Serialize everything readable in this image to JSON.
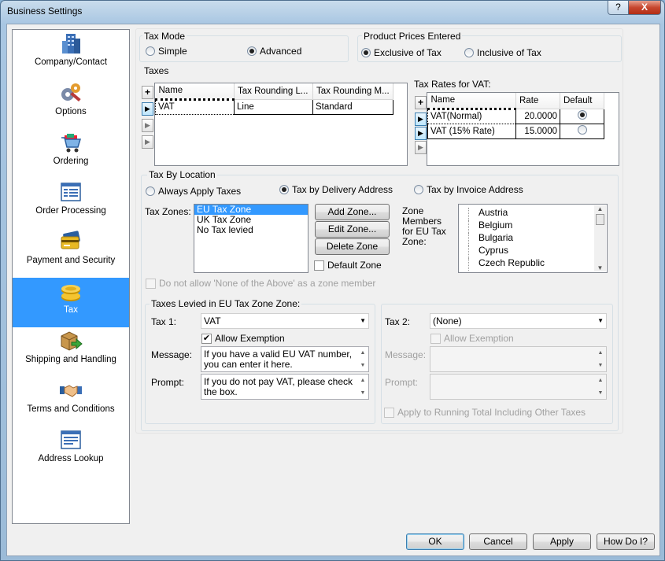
{
  "window": {
    "title": "Business Settings",
    "help_label": "?",
    "close_label": "X"
  },
  "sidebar": {
    "items": [
      {
        "label": "Company/Contact",
        "icon": "building-icon"
      },
      {
        "label": "Options",
        "icon": "gears-icon"
      },
      {
        "label": "Ordering",
        "icon": "shopping-cart-icon"
      },
      {
        "label": "Order Processing",
        "icon": "form-icon"
      },
      {
        "label": "Payment and Security",
        "icon": "credit-card-icon"
      },
      {
        "label": "Tax",
        "icon": "coins-icon",
        "selected": true
      },
      {
        "label": "Shipping and Handling",
        "icon": "box-arrow-icon"
      },
      {
        "label": "Terms and Conditions",
        "icon": "handshake-icon"
      },
      {
        "label": "Address Lookup",
        "icon": "address-form-icon"
      }
    ]
  },
  "tax_mode": {
    "label": "Tax Mode",
    "simple": "Simple",
    "advanced": "Advanced",
    "selected": "Advanced"
  },
  "prices": {
    "label": "Product Prices Entered",
    "exclusive": "Exclusive of Tax",
    "inclusive": "Inclusive of Tax",
    "selected": "Exclusive of Tax"
  },
  "taxes": {
    "label": "Taxes",
    "plus": "+",
    "columns": [
      "Name",
      "Tax Rounding L...",
      "Tax Rounding M..."
    ],
    "rows": [
      {
        "name": "VAT",
        "rl": "Line",
        "rm": "Standard"
      }
    ]
  },
  "rates": {
    "label": "Tax Rates for VAT:",
    "plus": "+",
    "columns": [
      "Name",
      "Rate",
      "Default"
    ],
    "rows": [
      {
        "name": "VAT(Normal)",
        "rate": "20.0000",
        "default": true
      },
      {
        "name": "VAT (15% Rate)",
        "rate": "15.0000",
        "default": false
      }
    ]
  },
  "location": {
    "label": "Tax By Location",
    "always": "Always Apply Taxes",
    "delivery": "Tax by Delivery Address",
    "invoice": "Tax by Invoice Address",
    "selected": "Tax by Delivery Address",
    "zones_label": "Tax Zones:",
    "zones": [
      "EU Tax Zone",
      "UK Tax Zone",
      "No Tax levied"
    ],
    "add_zone": "Add Zone...",
    "edit_zone": "Edit Zone...",
    "delete_zone": "Delete Zone",
    "default_zone": "Default Zone",
    "members_label": "Zone Members for EU Tax Zone:",
    "members": [
      "Austria",
      "Belgium",
      "Bulgaria",
      "Cyprus",
      "Czech Republic"
    ],
    "none_above": "Do not allow 'None of the Above' as a zone member"
  },
  "levied": {
    "label": "Taxes Levied in EU Tax Zone Zone:",
    "tax1_label": "Tax 1:",
    "tax1": "VAT",
    "allow_exemption": "Allow Exemption",
    "message_label": "Message:",
    "message": "If you have a valid EU VAT number, you can enter it here.",
    "prompt_label": "Prompt:",
    "prompt": "If you do not pay VAT, please check the box.",
    "tax2_label": "Tax 2:",
    "tax2": "(None)",
    "allow_exemption2": "Allow Exemption",
    "message2_label": "Message:",
    "prompt2_label": "Prompt:",
    "apply_running": "Apply to Running Total Including Other Taxes"
  },
  "buttons": {
    "ok": "OK",
    "cancel": "Cancel",
    "apply": "Apply",
    "howdo": "How Do I?"
  }
}
